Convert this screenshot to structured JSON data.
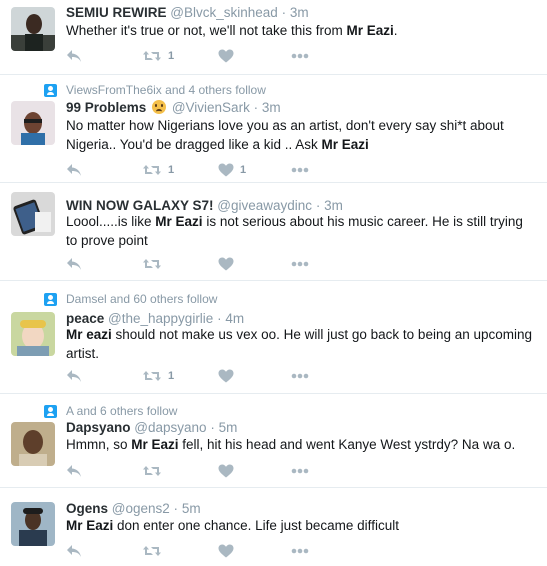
{
  "tweets": [
    {
      "context": null,
      "name": "SEMIU REWIRE",
      "handle": "@Blvck_skinhead",
      "time": "3m",
      "has_emoji": false,
      "text_parts": [
        {
          "t": "Whether it's true or not, we'll not take this from ",
          "b": false
        },
        {
          "t": "Mr Eazi",
          "b": true
        },
        {
          "t": ".",
          "b": false
        }
      ],
      "retweets": "1",
      "likes": ""
    },
    {
      "context": "ViewsFromThe6ix and 4 others follow",
      "name": "99 Problems",
      "handle": "@VivienSark",
      "time": "3m",
      "has_emoji": true,
      "text_parts": [
        {
          "t": "No matter how Nigerians love you as an artist, don't every say shi*t about Nigeria.. You'd be dragged like a kid .. Ask ",
          "b": false
        },
        {
          "t": "Mr Eazi",
          "b": true
        }
      ],
      "retweets": "1",
      "likes": "1"
    },
    {
      "context": null,
      "name": "WIN NOW GALAXY S7!",
      "handle": "@giveawaydinc",
      "time": "3m",
      "has_emoji": false,
      "text_parts": [
        {
          "t": "Loool.....is like ",
          "b": false
        },
        {
          "t": "Mr Eazi",
          "b": true
        },
        {
          "t": " is not serious about his music career. He is still trying to prove point",
          "b": false
        }
      ],
      "retweets": "",
      "likes": ""
    },
    {
      "context": "Damsel and 60 others follow",
      "name": "peace",
      "handle": "@the_happygirlie",
      "time": "4m",
      "has_emoji": false,
      "text_parts": [
        {
          "t": "Mr eazi",
          "b": true
        },
        {
          "t": " should not make us vex oo.  He will just go back to being an upcoming artist.",
          "b": false
        }
      ],
      "retweets": "1",
      "likes": ""
    },
    {
      "context": "A and 6 others follow",
      "name": "Dapsyano",
      "handle": "@dapsyano",
      "time": "5m",
      "has_emoji": false,
      "text_parts": [
        {
          "t": "Hmmn, so ",
          "b": false
        },
        {
          "t": "Mr Eazi",
          "b": true
        },
        {
          "t": " fell, hit his head and went Kanye West ystrdy? Na wa o.",
          "b": false
        }
      ],
      "retweets": "",
      "likes": ""
    },
    {
      "context": null,
      "name": "Ogens",
      "handle": "@ogens2",
      "time": "5m",
      "has_emoji": false,
      "text_parts": [
        {
          "t": "Mr Eazi",
          "b": true
        },
        {
          "t": " don enter one chance. Life just became difficult",
          "b": false
        }
      ],
      "retweets": "",
      "likes": ""
    }
  ],
  "icons": {
    "reply": "reply-icon",
    "retweet": "retweet-icon",
    "like": "heart-icon",
    "more": "more-icon",
    "follow": "follow-icon"
  },
  "colors": {
    "icon": "#aab8c2",
    "muted": "#8899a6",
    "accent": "#1da1f2",
    "divider": "#e6ecf0"
  }
}
